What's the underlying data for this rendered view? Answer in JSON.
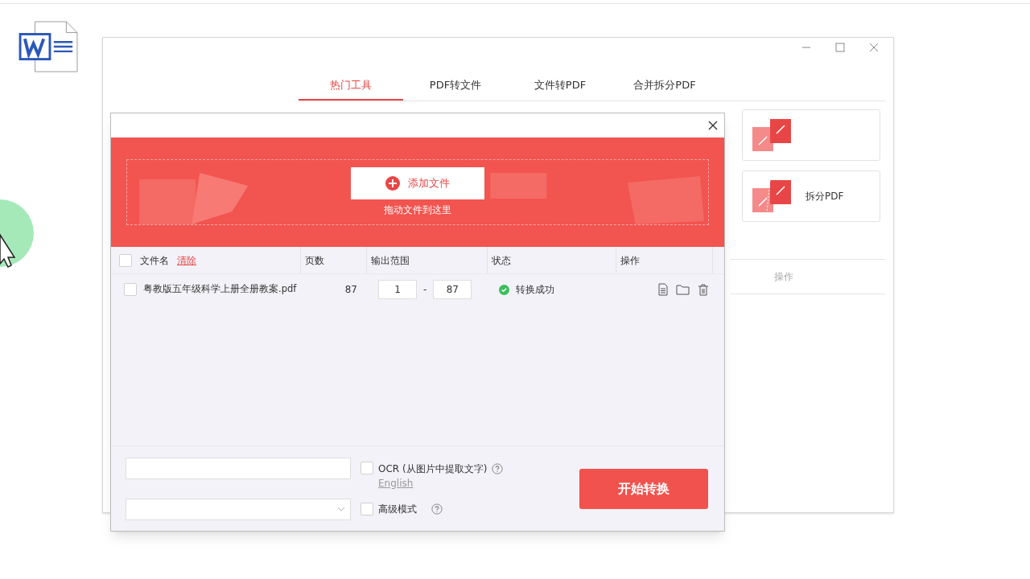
{
  "main_window": {
    "tabs": [
      {
        "label": "热门工具",
        "selected": true
      },
      {
        "label": "PDF转文件",
        "selected": false
      },
      {
        "label": "文件转PDF",
        "selected": false
      },
      {
        "label": "合并拆分PDF",
        "selected": false
      }
    ],
    "tool_cards": [
      {
        "kind": "merge"
      },
      {
        "kind": "split",
        "label": "拆分PDF"
      }
    ],
    "list_header": "操作"
  },
  "dialog": {
    "add_button": "添加文件",
    "drop_hint": "拖动文件到这里",
    "select_all": {
      "checked": false
    },
    "clear_link": "清除",
    "columns": [
      "文件名",
      "页数",
      "输出范围",
      "状态",
      "操作"
    ],
    "rows": [
      {
        "checked": false,
        "name": "粤教版五年级科学上册全册教案.pdf",
        "pages": "87",
        "from": "1",
        "separator": "-",
        "to": "87",
        "status": "转换成功",
        "kind": "success"
      }
    ],
    "ocr": {
      "label": "OCR (从图片中提取文字)",
      "checked": false,
      "language": "English"
    },
    "advanced": {
      "label": "高级模式",
      "checked": false
    },
    "start_button": "开始转换"
  }
}
